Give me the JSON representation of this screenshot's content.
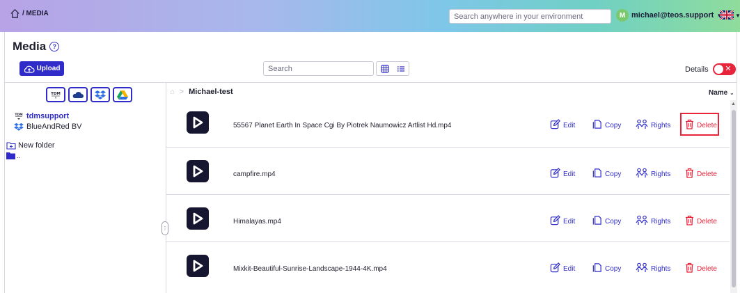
{
  "topbar": {
    "breadcrumb": "/ MEDIA",
    "search_placeholder": "Search anywhere in your environment",
    "user_initial": "M",
    "user_email": "michael@teos.support"
  },
  "header": {
    "title": "Media",
    "upload_label": "Upload",
    "search_placeholder": "Search",
    "details_label": "Details"
  },
  "sidebar": {
    "root_label": "tdmsupport",
    "org_label": "BlueAndRed BV",
    "new_folder_label": "New folder",
    "up_label": ".."
  },
  "main": {
    "path_label": "Michael-test",
    "sort_label": "Name",
    "action_labels": {
      "edit": "Edit",
      "copy": "Copy",
      "rights": "Rights",
      "delete": "Delete"
    },
    "files": [
      {
        "name": "55567 Planet Earth In Space Cgi By Piotrek Naumowicz Artlist Hd.mp4"
      },
      {
        "name": "campfire.mp4"
      },
      {
        "name": "Himalayas.mp4"
      },
      {
        "name": "Mixkit-Beautiful-Sunrise-Landscape-1944-4K.mp4"
      }
    ]
  },
  "colors": {
    "accent": "#2f2cc9",
    "danger": "#e8243a",
    "thumb": "#161630"
  }
}
